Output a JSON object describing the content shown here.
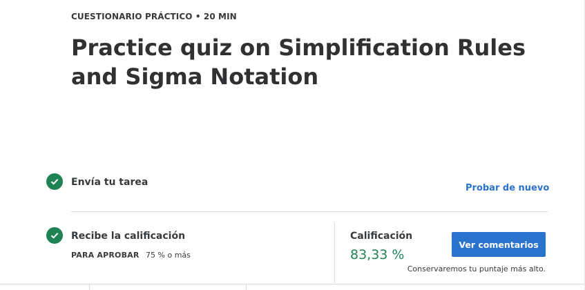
{
  "header": {
    "meta": "CUESTIONARIO PRÁCTICO • 20 MIN",
    "title": "Practice quiz on Simplification Rules and Sigma Notation"
  },
  "steps": [
    {
      "label": "Envía tu tarea",
      "action_label": "Probar de nuevo",
      "status": "complete"
    },
    {
      "label": "Recibe la calificación",
      "status": "complete"
    }
  ],
  "pass": {
    "label": "PARA APROBAR",
    "value": "75 % o más"
  },
  "grade": {
    "label": "Calificación",
    "value": "83,33 %",
    "button_label": "Ver comentarios",
    "note": "Conservaremos tu puntaje más alto."
  },
  "icons": {
    "step_status": "check-circle-icon"
  },
  "colors": {
    "success": "#1f8354",
    "primary": "#2a73cc"
  }
}
